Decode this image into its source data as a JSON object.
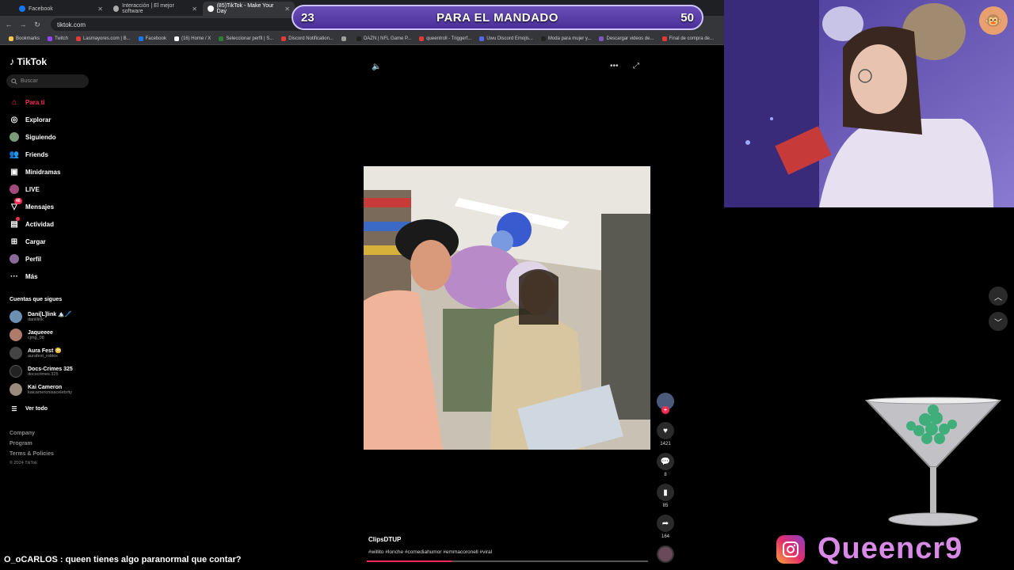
{
  "browser": {
    "tabs": [
      {
        "label": "Facebook",
        "color": "#1877f2"
      },
      {
        "label": "Interacción | El mejor software",
        "color": "#aaaaaa"
      },
      {
        "label": "(85)TikTok - Make Your Day",
        "color": "#ffffff"
      }
    ],
    "url": "tiktok.com",
    "bookmarks": [
      {
        "label": "Bookmarks",
        "color": "#f2c94c"
      },
      {
        "label": "Twitch",
        "color": "#9146ff"
      },
      {
        "label": "Lasmayores.com | B...",
        "color": "#e53935"
      },
      {
        "label": "Facebook",
        "color": "#1877f2"
      },
      {
        "label": "(16) Home / X",
        "color": "#ffffff"
      },
      {
        "label": "Seleccionar perfil | S...",
        "color": "#2e7d32"
      },
      {
        "label": "Discord Notification...",
        "color": "#e53935"
      },
      {
        "label": "",
        "color": "#9e9e9e"
      },
      {
        "label": "DAZN | NFL Game P...",
        "color": "#222222"
      },
      {
        "label": "queentroll - Triggerf...",
        "color": "#e53935"
      },
      {
        "label": "Uwu Discord Emojis...",
        "color": "#5865f2"
      },
      {
        "label": "Moda para mujer y...",
        "color": "#222222"
      },
      {
        "label": "Descargar videos de...",
        "color": "#7e57c2"
      },
      {
        "label": "Final de compra de...",
        "color": "#e53935"
      }
    ]
  },
  "score": {
    "left": "23",
    "title": "PARA EL MANDADO",
    "right": "50"
  },
  "sidebar": {
    "logo": "TikTok",
    "search_placeholder": "Buscar",
    "nav": [
      {
        "label": "Para ti",
        "icon": "home-icon"
      },
      {
        "label": "Explorar",
        "icon": "compass-icon"
      },
      {
        "label": "Siguiendo",
        "icon": "following-icon"
      },
      {
        "label": "Friends",
        "icon": "friends-icon"
      },
      {
        "label": "Minidramas",
        "icon": "minidramas-icon"
      },
      {
        "label": "LIVE",
        "icon": "live-icon"
      },
      {
        "label": "Mensajes",
        "icon": "messages-icon",
        "badge": "46"
      },
      {
        "label": "Actividad",
        "icon": "activity-icon"
      },
      {
        "label": "Cargar",
        "icon": "upload-icon"
      },
      {
        "label": "Perfil",
        "icon": "profile-icon"
      },
      {
        "label": "Más",
        "icon": "more-icon"
      }
    ],
    "following_title": "Cuentas que sigues",
    "accounts": [
      {
        "name": "Dani[L]link 🏔️🖊️",
        "handle": "danillink",
        "color": "#6a8fb0"
      },
      {
        "name": "Jaqueeee",
        "handle": "cjmg_08",
        "color": "#b07a6a"
      },
      {
        "name": "Aura Fest 😳",
        "handle": "aurafest_roblox",
        "color": "#444444"
      },
      {
        "name": "Docs-Crimes 325",
        "handle": "docscrimes.325",
        "color": "#222222"
      },
      {
        "name": "Kai Cameron",
        "handle": "kaicameronisacelebrity",
        "color": "#9a8a80"
      }
    ],
    "see_all": "Ver todo",
    "footer": [
      "Company",
      "Program",
      "Terms & Policies"
    ],
    "copyright": "© 2024 TikTok"
  },
  "video": {
    "author": "ClipsDTUP",
    "tags": "#willito #lonche #comediahumor #emmacoronell #viral",
    "progress": 0.3
  },
  "actions": {
    "likes": "1421",
    "comments": "8",
    "saves": "85",
    "shares": "164"
  },
  "stream": {
    "chat_line": "O_oCARLOS : queen tienes algo paranormal que contar?",
    "handle": "Queencr9"
  }
}
